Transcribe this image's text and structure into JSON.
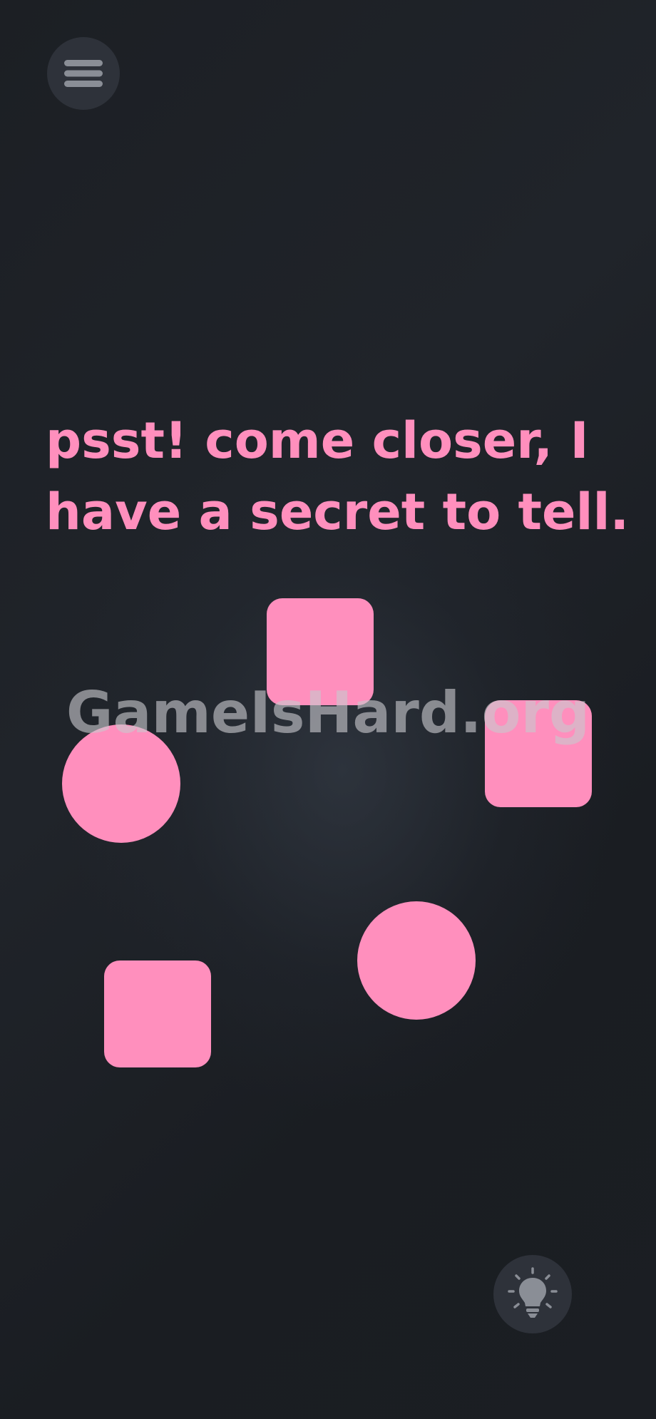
{
  "game": {
    "message": "psst! come closer, I\nhave a secret to tell.",
    "watermark": "GameIsHard.org",
    "accent_color": "#ff8fbd",
    "background_color": "#1b1e23",
    "menu_button": {
      "icon": "hamburger-menu-icon"
    },
    "hint_button": {
      "icon": "lightbulb-icon"
    },
    "shapes": [
      {
        "id": "square-top",
        "kind": "square"
      },
      {
        "id": "square-right",
        "kind": "square"
      },
      {
        "id": "circle-left",
        "kind": "circle"
      },
      {
        "id": "circle-bottom-right",
        "kind": "circle"
      },
      {
        "id": "square-bottom-left",
        "kind": "square"
      }
    ]
  }
}
